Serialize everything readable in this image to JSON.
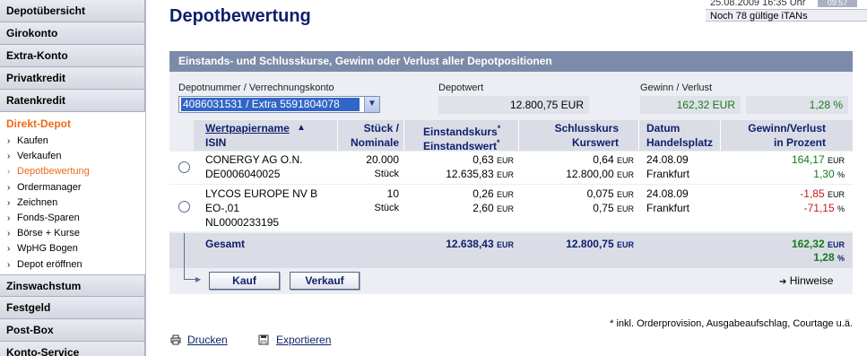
{
  "sidebar": {
    "top_items": [
      "Depotübersicht",
      "Girokonto",
      "Extra-Konto",
      "Privatkredit",
      "Ratenkredit"
    ],
    "active_section": "Direkt-Depot",
    "sub_items": [
      {
        "label": "Kaufen",
        "active": false
      },
      {
        "label": "Verkaufen",
        "active": false
      },
      {
        "label": "Depotbewertung",
        "active": true
      },
      {
        "label": "Ordermanager",
        "active": false
      },
      {
        "label": "Zeichnen",
        "active": false
      },
      {
        "label": "Fonds-Sparen",
        "active": false
      },
      {
        "label": "Börse + Kurse",
        "active": false
      },
      {
        "label": "WpHG Bogen",
        "active": false
      },
      {
        "label": "Depot eröffnen",
        "active": false
      }
    ],
    "bottom_items": [
      "Zinswachstum",
      "Festgeld",
      "Post-Box",
      "Konto-Service"
    ]
  },
  "topinfo": {
    "datetime": "25.08.2009 16:35 Uhr",
    "timer": "09:57",
    "itans": "Noch 78 gültige iTANs"
  },
  "page": {
    "title": "Depotbewertung",
    "panel_header": "Einstands- und Schlusskurse, Gewinn oder Verlust aller Depotpositionen"
  },
  "summary": {
    "konto_label": "Depotnummer / Verrechnungskonto",
    "konto_value": "4086031531 / Extra 5591804078",
    "depotwert_label": "Depotwert",
    "depotwert_value": "12.800,75 EUR",
    "gv_label": "Gewinn / Verlust",
    "gv_value": "162,32 EUR",
    "gv_percent": "1,28 %"
  },
  "table": {
    "headers": {
      "name": "Wertpapiername",
      "sort_icon": "▲",
      "isin": "ISIN",
      "stueck": "Stück /",
      "nominale": "Nominale",
      "einstandskurs": "Einstandskurs",
      "einstandswert": "Einstandswert",
      "star": "*",
      "schlusskurs": "Schlusskurs",
      "kurswert": "Kurswert",
      "datum": "Datum",
      "handelsplatz": "Handelsplatz",
      "gv": "Gewinn/Verlust",
      "gv_pct": "in Prozent"
    },
    "rows": [
      {
        "name_lines": [
          "CONERGY AG O.N.",
          "DE0006040025"
        ],
        "stueck": "20.000",
        "unit": "Stück",
        "einstandskurs": "0,63",
        "einstandswert": "12.635,83",
        "schlusskurs": "0,64",
        "kurswert": "12.800,00",
        "datum": "24.08.09",
        "handelsplatz": "Frankfurt",
        "gv": "164,17",
        "gv_pct": "1,30"
      },
      {
        "name_lines": [
          "LYCOS EUROPE NV B",
          "EO-,01",
          "NL0000233195"
        ],
        "stueck": "10",
        "unit": "Stück",
        "einstandskurs": "0,26",
        "einstandswert": "2,60",
        "schlusskurs": "0,075",
        "kurswert": "0,75",
        "datum": "24.08.09",
        "handelsplatz": "Frankfurt",
        "gv": "-1,85",
        "gv_pct": "-71,15"
      }
    ],
    "total": {
      "label": "Gesamt",
      "einstandswert": "12.638,43",
      "kurswert": "12.800,75",
      "gv": "162,32",
      "gv_pct": "1,28"
    },
    "currency": "EUR",
    "pct": "%"
  },
  "actions": {
    "buy": "Kauf",
    "sell": "Verkauf",
    "hints": "Hinweise",
    "hints_arrow": "➔"
  },
  "footnote": "* inkl. Orderprovision, Ausgabeaufschlag, Courtage u.ä.",
  "bottom": {
    "print": "Drucken",
    "export": "Exportieren"
  },
  "colors": {
    "title": "#0e1f6b",
    "active_nav": "#ee6a15",
    "panel_header": "#7d8bab",
    "gain": "#167a1c",
    "loss": "#c8181e"
  }
}
